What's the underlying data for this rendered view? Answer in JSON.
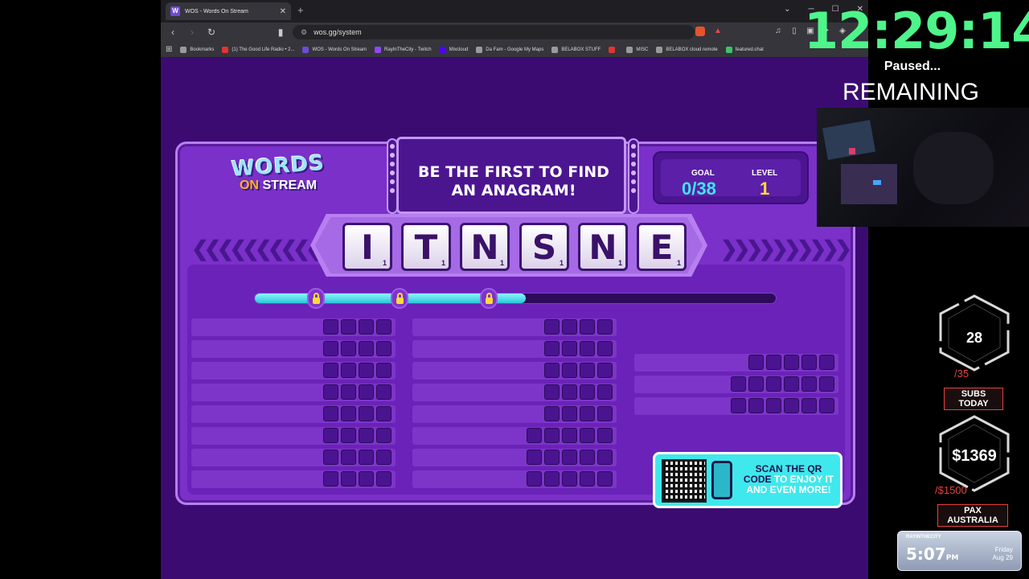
{
  "browser": {
    "tab_title": "WOS - Words On Stream",
    "tab_favicon": "W",
    "url": "wos.gg/system",
    "bookmarks": [
      {
        "label": "Bookmarks",
        "color": "#9a9a9a"
      },
      {
        "label": "(1) The Good Life Radio • 2...",
        "color": "#e23333"
      },
      {
        "label": "WOS - Words On Stream",
        "color": "#6d4bd8"
      },
      {
        "label": "RayInTheCity - Twitch",
        "color": "#9146ff"
      },
      {
        "label": "Mixcloud",
        "color": "#5000ff"
      },
      {
        "label": "Da Fam - Google My Maps",
        "color": "#9a9a9a"
      },
      {
        "label": "BELABOX STUFF",
        "color": "#9a9a9a"
      },
      {
        "label": "",
        "color": "#e23333"
      },
      {
        "label": "MISC",
        "color": "#9a9a9a"
      },
      {
        "label": "BELABOX cloud remote",
        "color": "#9a9a9a"
      },
      {
        "label": "featured.chat",
        "color": "#3cc36a"
      }
    ]
  },
  "game": {
    "logo_top": "WORDS",
    "logo_on": "ON",
    "logo_bottom": "STREAM",
    "banner": "BE THE FIRST TO FIND AN ANAGRAM!",
    "goal_label": "GOAL",
    "goal_value": "0/38",
    "level_label": "LEVEL",
    "level_value": "1",
    "letters": [
      {
        "l": "I",
        "s": "1"
      },
      {
        "l": "T",
        "s": "1"
      },
      {
        "l": "N",
        "s": "1"
      },
      {
        "l": "S",
        "s": "1"
      },
      {
        "l": "N",
        "s": "1"
      },
      {
        "l": "E",
        "s": "1"
      }
    ],
    "progress": 0.52,
    "qr_line1": "SCAN THE QR",
    "qr_line2a": "CODE",
    "qr_line2b": " TO ENJOY IT",
    "qr_line3": "AND EVEN MORE!",
    "colors": {
      "goal": "#3ee6f0",
      "level": "#ffd93a"
    }
  },
  "overlay": {
    "timer": "12:29:14",
    "status": "Paused...",
    "remaining": "REMAINING",
    "subs_value": "28",
    "subs_goal": "/35",
    "subs_label": "SUBS TODAY",
    "money_value": "$1369",
    "money_goal": "/$1500",
    "money_label": "PAX AUSTRALIA",
    "widget_name": "RAYINTHECITY",
    "widget_time": "5:07",
    "widget_ampm": "PM",
    "widget_day": "Friday",
    "widget_date": "Aug 29"
  }
}
